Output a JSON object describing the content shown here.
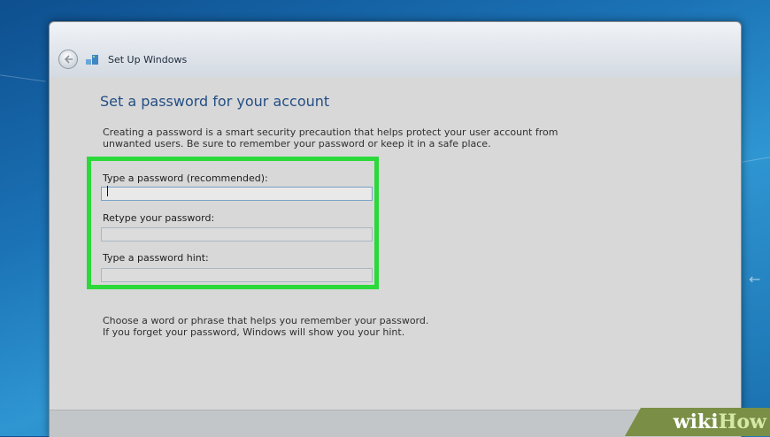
{
  "window": {
    "title": "Set Up Windows"
  },
  "page": {
    "heading": "Set a password for your account",
    "description_line1": "Creating a password is a smart security precaution that helps protect your user account from",
    "description_line2": "unwanted users. Be sure to remember your password or keep it in a safe place."
  },
  "fields": {
    "password_label": "Type a password (recommended):",
    "password_value": "",
    "retype_label": "Retype your password:",
    "retype_value": "",
    "hint_label": "Type a password hint:",
    "hint_value": ""
  },
  "hint_help": {
    "line1": "Choose a word or phrase that helps you remember your password.",
    "line2": "If you forget your password, Windows will show you your hint."
  },
  "watermark": {
    "part1": "wiki",
    "part2": "How"
  },
  "colors": {
    "highlight": "#2bd93a",
    "heading": "#244e84",
    "watermark_bg": "#7a8f45"
  },
  "icons": [
    "back-arrow-icon",
    "windows-setup-icon"
  ]
}
